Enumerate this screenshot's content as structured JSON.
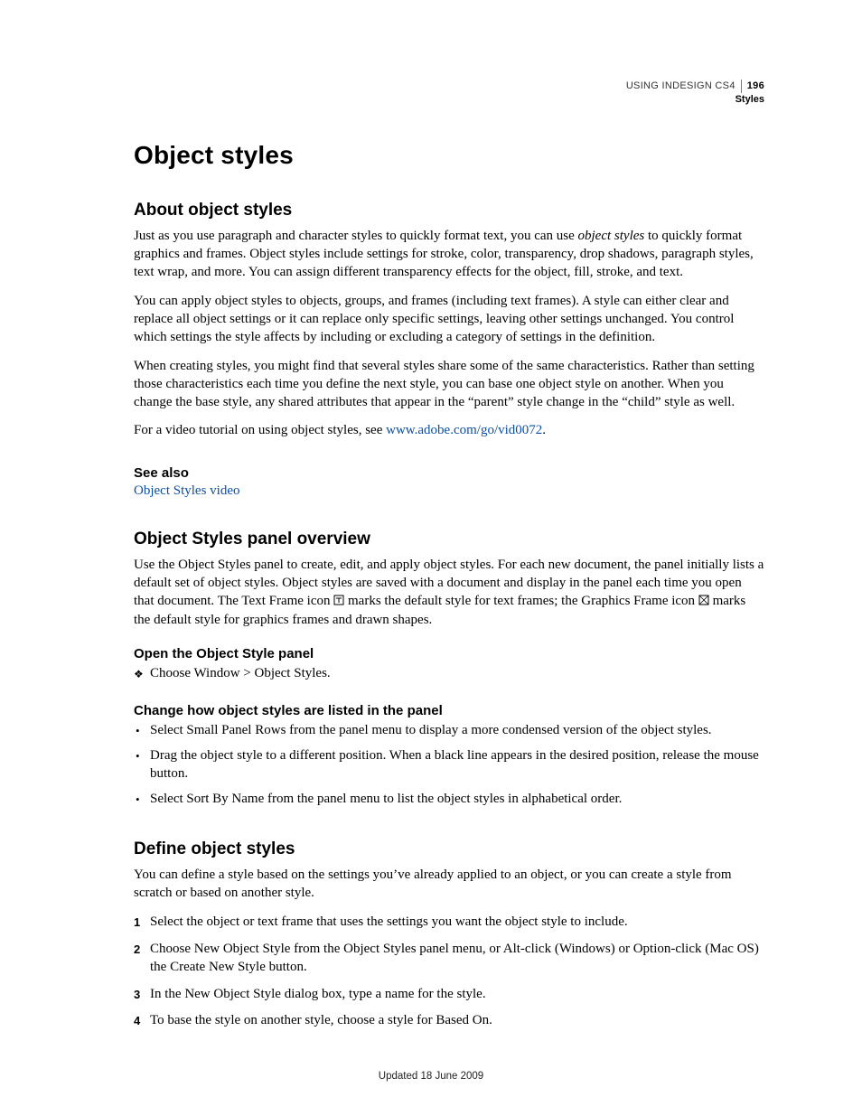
{
  "header": {
    "doc_title": "USING INDESIGN CS4",
    "section": "Styles",
    "page_number": "196"
  },
  "chapter_title": "Object styles",
  "about": {
    "heading": "About object styles",
    "p1_a": "Just as you use paragraph and character styles to quickly format text, you can use ",
    "p1_em": "object styles",
    "p1_b": " to quickly format graphics and frames. Object styles include settings for stroke, color, transparency, drop shadows, paragraph styles, text wrap, and more. You can assign different transparency effects for the object, fill, stroke, and text.",
    "p2": "You can apply object styles to objects, groups, and frames (including text frames). A style can either clear and replace all object settings or it can replace only specific settings, leaving other settings unchanged. You control which settings the style affects by including or excluding a category of settings in the definition.",
    "p3": "When creating styles, you might find that several styles share some of the same characteristics. Rather than setting those characteristics each time you define the next style, you can base one object style on another. When you change the base style, any shared attributes that appear in the “parent” style change in the “child” style as well.",
    "p4_a": "For a video tutorial on using object styles, see ",
    "p4_link": "www.adobe.com/go/vid0072",
    "p4_b": "."
  },
  "seealso": {
    "heading": "See also",
    "link": "Object Styles video"
  },
  "overview": {
    "heading": "Object Styles panel overview",
    "p1_a": "Use the Object Styles panel to create, edit, and apply object styles. For each new document, the panel initially lists a default set of object styles. Object styles are saved with a document and display in the panel each time you open that document. The Text Frame icon ",
    "p1_b": " marks the default style for text frames; the Graphics Frame icon ",
    "p1_c": " marks the default style for graphics frames and drawn shapes.",
    "open": {
      "heading": "Open the Object Style panel",
      "item": "Choose Window > Object Styles."
    },
    "change": {
      "heading": "Change how object styles are listed in the panel",
      "b1": "Select Small Panel Rows from the panel menu to display a more condensed version of the object styles.",
      "b2": "Drag the object style to a different position. When a black line appears in the desired position, release the mouse button.",
      "b3": "Select Sort By Name from the panel menu to list the object styles in alphabetical order."
    }
  },
  "define": {
    "heading": "Define object styles",
    "p1": "You can define a style based on the settings you’ve already applied to an object, or you can create a style from scratch or based on another style.",
    "steps": {
      "s1": "Select the object or text frame that uses the settings you want the object style to include.",
      "s2": "Choose New Object Style from the Object Styles panel menu, or Alt-click (Windows) or Option-click (Mac OS) the Create New Style button.",
      "s3": "In the New Object Style dialog box, type a name for the style.",
      "s4": "To base the style on another style, choose a style for Based On."
    }
  },
  "footer": "Updated 18 June 2009"
}
